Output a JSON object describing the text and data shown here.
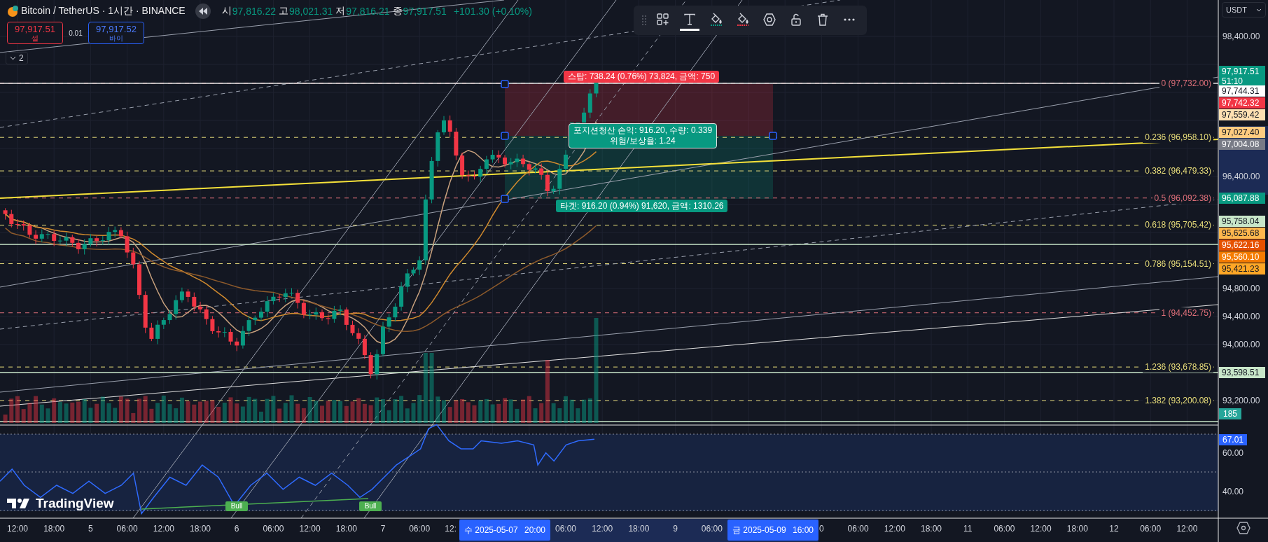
{
  "header": {
    "symbol": "Bitcoin / TetherUS · 1시간 · BINANCE",
    "ohlc": [
      {
        "label": "시",
        "value": "97,816.22"
      },
      {
        "label": "고",
        "value": "98,021.31"
      },
      {
        "label": "저",
        "value": "97,816.21"
      },
      {
        "label": "종",
        "value": "97,917.51"
      }
    ],
    "change": "+101.30 (+0.10%)"
  },
  "trade": {
    "sell": {
      "price": "97,917.51",
      "label": "셀"
    },
    "spread": "0.01",
    "buy": {
      "price": "97,917.52",
      "label": "바이"
    }
  },
  "indicators_toggle": {
    "count": "2"
  },
  "toolbar": {
    "tools": [
      {
        "kind": "widgets",
        "selected": false
      },
      {
        "kind": "text",
        "selected": true
      },
      {
        "kind": "fill-up",
        "selected": false
      },
      {
        "kind": "fill-down",
        "selected": false
      },
      {
        "kind": "settings",
        "selected": false
      },
      {
        "kind": "lock",
        "selected": false
      },
      {
        "kind": "delete",
        "selected": false
      },
      {
        "kind": "more",
        "selected": false
      }
    ]
  },
  "currency": "USDT",
  "price_axis": {
    "ticks": [
      "98,400.00",
      "96,400.00",
      "94,800.00",
      "94,400.00",
      "94,000.00",
      "93,200.00"
    ]
  },
  "price_tags": [
    {
      "label": "97,917.51",
      "sub": "51:10",
      "color": "#089981"
    },
    {
      "label": "97,744.31",
      "color": "#ffffff"
    },
    {
      "label": "97,742.32",
      "color": "#f23645"
    },
    {
      "label": "97,559.42",
      "color": "#ffe0b2"
    },
    {
      "label": "97,027.40",
      "color": "#ffcc80"
    },
    {
      "label": "97,004.08",
      "color": "#787b86"
    },
    {
      "label": "96,087.88",
      "color": "#089981"
    },
    {
      "label": "95,758.04",
      "color": "#c8e6c9"
    },
    {
      "label": "95,625.68",
      "color": "#ffb74d"
    },
    {
      "label": "95,622.16",
      "color": "#e65100"
    },
    {
      "label": "95,560.10",
      "color": "#f57c00"
    },
    {
      "label": "95,421.23",
      "color": "#ffa726"
    },
    {
      "label": "93,598.51",
      "color": "#c8e6c9"
    }
  ],
  "volume_tag": "185",
  "fib_levels": [
    {
      "label": "0 (97,732.00)",
      "color": "#e0707a"
    },
    {
      "label": "0.236 (96,958.10)",
      "color": "#e8dd7a"
    },
    {
      "label": "0.382 (96,479.33)",
      "color": "#e8dd7a"
    },
    {
      "label": "0.5 (96,092.38)",
      "color": "#e0707a"
    },
    {
      "label": "0.618 (95,705.42)",
      "color": "#e8dd7a"
    },
    {
      "label": "0.786 (95,154.51)",
      "color": "#e8dd7a"
    },
    {
      "label": "1 (94,452.75)",
      "color": "#e0707a"
    },
    {
      "label": "1.236 (93,678.85)",
      "color": "#e8dd7a"
    },
    {
      "label": "1.382 (93,200.08)",
      "color": "#e8dd7a"
    }
  ],
  "position": {
    "stop": "스탑: 738.24 (0.76%) 73,824, 금액: 750",
    "summary": [
      "포지션청산 손익: 916.20, 수량: 0.339",
      "위험/보상율: 1.24"
    ],
    "target": "타겟: 916.20 (0.94%) 91,620, 금액: 1310.26"
  },
  "rsi": {
    "value": "67.01",
    "ticks": [
      "60.00",
      "40.00"
    ],
    "signals": [
      "Bull",
      "Bull"
    ]
  },
  "logo": "TradingView",
  "time_axis": {
    "labels": [
      "12:00",
      "18:00",
      "5",
      "06:00",
      "12:00",
      "18:00",
      "6",
      "06:00",
      "12:00",
      "18:00",
      "7",
      "06:00",
      "12:",
      "06:00",
      "12:00",
      "18:00",
      "9",
      "06:00",
      "0",
      "06:00",
      "12:00",
      "18:00",
      "11",
      "06:00",
      "12:00",
      "18:00",
      "12",
      "06:00",
      "12:00"
    ],
    "markers": [
      {
        "day": "수",
        "date": "2025-05-07",
        "time": "20:00"
      },
      {
        "day": "금",
        "date": "2025-05-09",
        "time": "16:00"
      }
    ]
  }
}
